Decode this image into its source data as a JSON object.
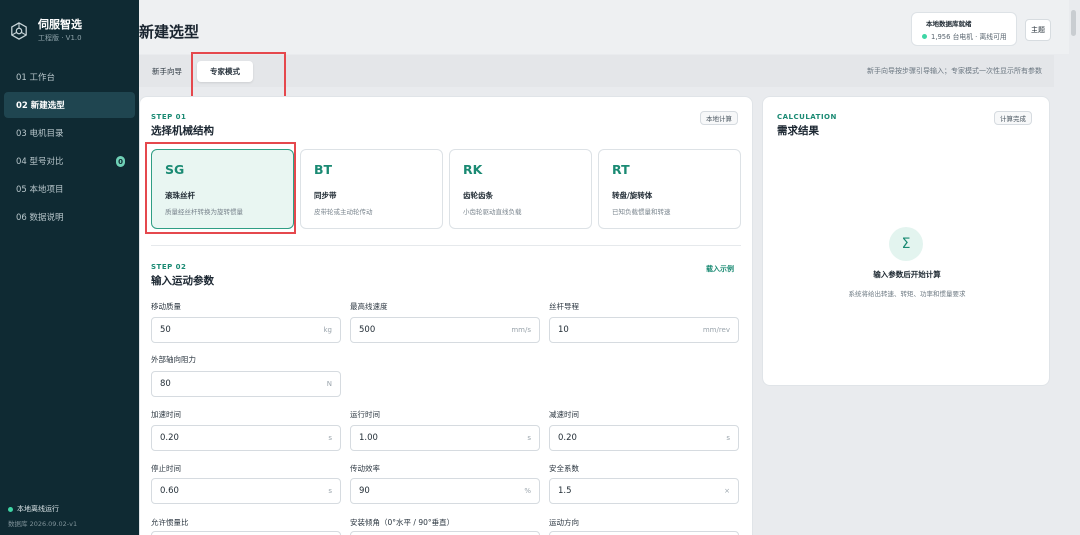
{
  "app": {
    "name": "伺服智选",
    "version": "工程版 · V1.0"
  },
  "sidebar": {
    "items": [
      {
        "label": "01 工作台"
      },
      {
        "label": "02 新建选型"
      },
      {
        "label": "03 电机目录"
      },
      {
        "label": "04 型号对比",
        "badge": "0"
      },
      {
        "label": "05 本地项目"
      },
      {
        "label": "06 数据说明"
      }
    ],
    "status": "本地离线运行",
    "db_version": "数据库 2026.09.02-v1"
  },
  "header": {
    "title": "新建选型",
    "db_card": {
      "title": "本地数据库就绪",
      "sub": "1,956 台电机 · 离线可用"
    },
    "theme_label": "主题"
  },
  "mode": {
    "tabs": [
      "新手向导",
      "专家模式"
    ],
    "hint": "新手向导按步骤引导输入；专家模式一次性显示所有参数"
  },
  "step1": {
    "tag": "STEP 01",
    "title": "选择机械结构",
    "chip": "本地计算",
    "mechanisms": [
      {
        "code": "SG",
        "name": "滚珠丝杆",
        "desc": "质量经丝杆转换为旋转惯量"
      },
      {
        "code": "BT",
        "name": "同步带",
        "desc": "皮带轮或主动轮传动"
      },
      {
        "code": "RK",
        "name": "齿轮齿条",
        "desc": "小齿轮驱动直线负载"
      },
      {
        "code": "RT",
        "name": "转盘/旋转体",
        "desc": "已知负载惯量和转速"
      }
    ]
  },
  "step2": {
    "tag": "STEP 02",
    "title": "输入运动参数",
    "load_example": "载入示例",
    "fields": [
      {
        "label": "移动质量",
        "value": "50",
        "unit": "kg"
      },
      {
        "label": "最高线速度",
        "value": "500",
        "unit": "mm/s"
      },
      {
        "label": "丝杆导程",
        "value": "10",
        "unit": "mm/rev"
      },
      {
        "label": "外部轴向阻力",
        "value": "80",
        "unit": "N"
      },
      {
        "label": "加速时间",
        "value": "0.20",
        "unit": "s"
      },
      {
        "label": "运行时间",
        "value": "1.00",
        "unit": "s"
      },
      {
        "label": "减速时间",
        "value": "0.20",
        "unit": "s"
      },
      {
        "label": "停止时间",
        "value": "0.60",
        "unit": "s"
      },
      {
        "label": "传动效率",
        "value": "90",
        "unit": "%"
      },
      {
        "label": "安全系数",
        "value": "1.5",
        "unit": "×"
      },
      {
        "label": "允许惯量比",
        "value": "",
        "unit": ""
      },
      {
        "label": "安装倾角（0°水平 / 90°垂直）",
        "value": "",
        "unit": ""
      },
      {
        "label": "运动方向",
        "value": "",
        "unit": ""
      }
    ]
  },
  "calculation": {
    "tag": "CALCULATION",
    "title": "需求结果",
    "chip": "计算完成",
    "icon_glyph": "Σ",
    "prompt": "输入参数后开始计算",
    "sub": "系统将给出转速、转矩、功率和惯量要求"
  },
  "colors": {
    "accent": "#1a8a73",
    "sidebar_bg": "#0f2a33",
    "annotation_red": "#e5484d"
  }
}
